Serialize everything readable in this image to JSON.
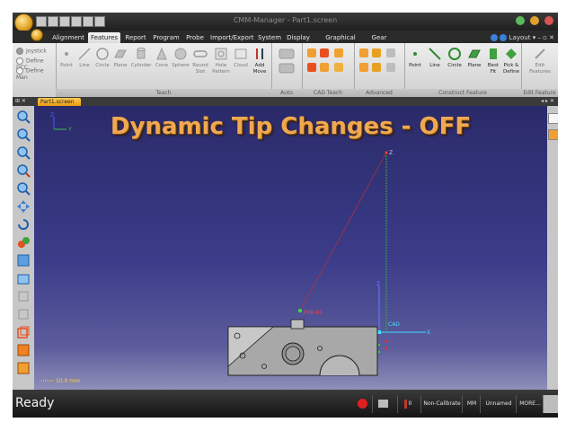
{
  "window": {
    "title": "CMM-Manager - Part1.screen"
  },
  "menu": {
    "tabs": [
      "Alignment",
      "Features",
      "Report",
      "Program",
      "Probe",
      "Import/Export",
      "System",
      "Display",
      "Graphical Report",
      "Gear"
    ],
    "active_tab": "Features",
    "layout_label": "Layout"
  },
  "ribbon": {
    "mode_options": [
      "Joystick",
      "Define DCC",
      "Define Man"
    ],
    "teach_items": [
      "Point",
      "Line",
      "Circle",
      "Plane",
      "Cylinder",
      "Cone",
      "Sphere",
      "Round Slot",
      "Hole Pattern",
      "Cloud",
      "Add Move"
    ],
    "group_labels": {
      "teach": "Teach",
      "auto": "Auto Feature",
      "cad": "CAD Teach",
      "advanced": "Advanced",
      "construct": "Construct Feature",
      "edit": "Edit Feature"
    },
    "construct_items": [
      "Point",
      "Line",
      "Circle",
      "Plane",
      "Best Fit",
      "Pick & Define",
      "Edit Features"
    ]
  },
  "document": {
    "tab_label": "Part1.screen",
    "panel_close": "x"
  },
  "viewport": {
    "heading": "Dynamic Tip Changes - OFF",
    "scale_label": "10.0 mm",
    "point_label": "P0B-01",
    "cad_label": "CAD",
    "axis_labels": {
      "z": "Z",
      "x": "X",
      "y": "Y"
    }
  },
  "status": {
    "ready": "Ready",
    "probe_count": "0",
    "calibration": "Non-Calibrate",
    "units": "MM",
    "name": "Unnamed",
    "more": "MORE..."
  },
  "colors": {
    "heading": "#f0a850",
    "viewport_top": "#2a2a6a",
    "ribbon": "#e6e6e6",
    "accent": "#e89a10"
  }
}
